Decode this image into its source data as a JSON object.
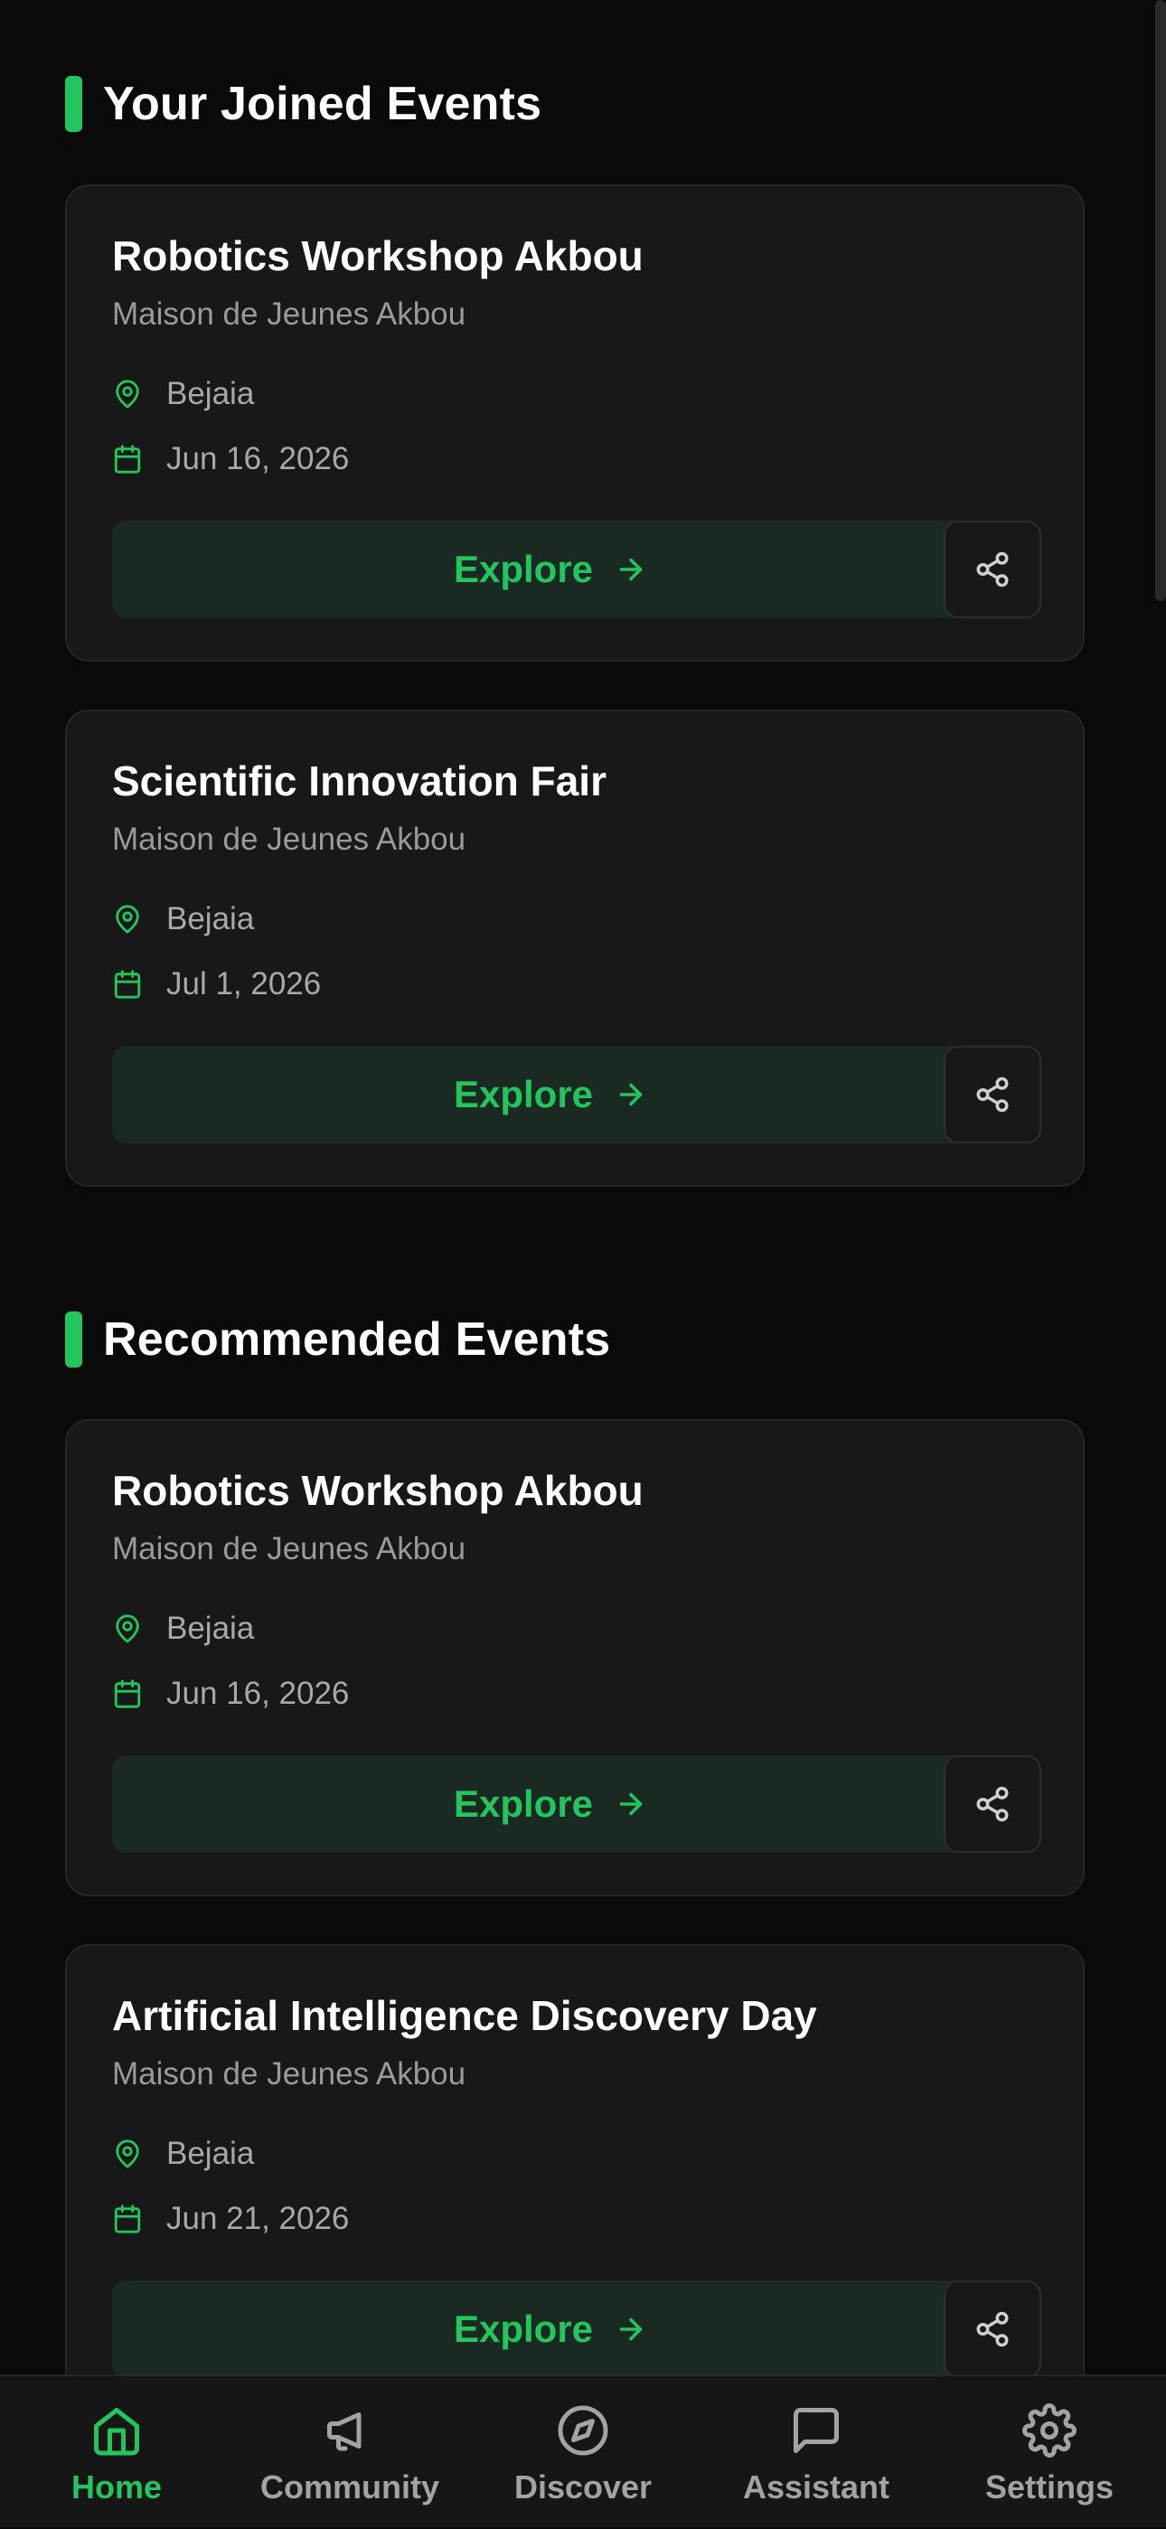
{
  "sections": {
    "joined": {
      "title": "Your Joined Events"
    },
    "recommended": {
      "title": "Recommended Events"
    }
  },
  "joined_events": [
    {
      "title": "Robotics Workshop Akbou",
      "organizer": "Maison de Jeunes Akbou",
      "location": "Bejaia",
      "date": "Jun 16, 2026",
      "action": "Explore"
    },
    {
      "title": "Scientific Innovation Fair",
      "organizer": "Maison de Jeunes Akbou",
      "location": "Bejaia",
      "date": "Jul 1, 2026",
      "action": "Explore"
    }
  ],
  "recommended_events": [
    {
      "title": "Robotics Workshop Akbou",
      "organizer": "Maison de Jeunes Akbou",
      "location": "Bejaia",
      "date": "Jun 16, 2026",
      "action": "Explore"
    },
    {
      "title": "Artificial Intelligence Discovery Day",
      "organizer": "Maison de Jeunes Akbou",
      "location": "Bejaia",
      "date": "Jun 21, 2026",
      "action": "Explore"
    }
  ],
  "icons": {
    "location": "map-pin-icon",
    "date": "calendar-icon",
    "explore": "arrow-right-icon",
    "share": "share-icon"
  },
  "bottom_nav": {
    "items": [
      {
        "label": "Home",
        "icon": "home-icon",
        "active": true
      },
      {
        "label": "Community",
        "icon": "megaphone-icon",
        "active": false
      },
      {
        "label": "Discover",
        "icon": "compass-icon",
        "active": false
      },
      {
        "label": "Assistant",
        "icon": "chat-icon",
        "active": false
      },
      {
        "label": "Settings",
        "icon": "gear-icon",
        "active": false
      }
    ]
  },
  "colors": {
    "accent": "#22c55e",
    "background": "#0a0a0a",
    "card": "#181818",
    "button_bg": "#1a2a22",
    "muted_text": "#a3a3a3"
  }
}
